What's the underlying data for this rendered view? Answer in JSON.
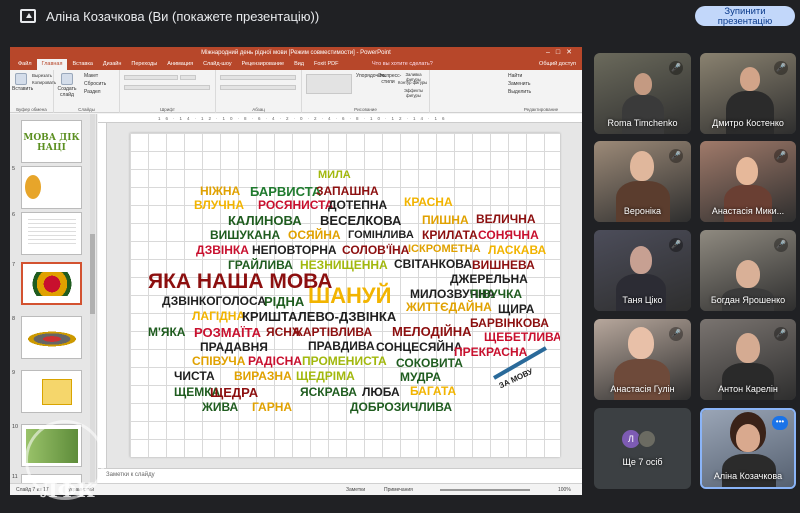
{
  "meet": {
    "title": "Аліна Козачкова (Ви (покажете презентацію))",
    "stop_button": "Зупинити\nпрезентацію"
  },
  "ppt": {
    "window_title": "Міжнародний день рідної мови  [Режим совместимости] - PowerPoint",
    "tabs": [
      "Файл",
      "Главная",
      "Вставка",
      "Дизайн",
      "Переходы",
      "Анимация",
      "Слайд-шоу",
      "Рецензирование",
      "Вид",
      "Foxit PDF"
    ],
    "tell_me": "Что вы хотите сделать?",
    "share": "Общий доступ",
    "ribbon": {
      "paste": "Вставить",
      "cut": "Вырезать",
      "copy": "Копировать",
      "format": "Формат по образцу",
      "clipboard": "Буфер обмена",
      "new_slide": "Создать слайд",
      "layout": "Макет",
      "reset": "Сбросить",
      "section": "Раздел",
      "slides": "Слайды",
      "font": "Шрифт",
      "paragraph": "Абзац",
      "arrange": "Упорядочить",
      "quick_styles": "Экспресс-стили",
      "shape_fill": "Заливка фигуры",
      "shape_outline": "Контур фигуры",
      "shape_effects": "Эффекты фигуры",
      "drawing": "Рисование",
      "find": "Найти",
      "replace": "Заменить",
      "select": "Выделить",
      "editing": "Редактирование"
    },
    "slide_numbers": [
      "5",
      "6",
      "7",
      "8",
      "9",
      "10",
      "11"
    ],
    "notes_placeholder": "Заметки к слайду",
    "status": {
      "slide": "Слайд 7 из 17",
      "language": "украинский",
      "notes": "Заметки",
      "comments": "Примечания",
      "zoom": "100%"
    },
    "thumb_title": "МОВА ДІК НАЦІ"
  },
  "slide_words": [
    {
      "t": "МИЛА",
      "c": "#a2b80d"
    },
    {
      "t": "НІЖНА",
      "c": "#e0a100"
    },
    {
      "t": "БАРВИСТА",
      "c": "#1f7a2e"
    },
    {
      "t": "ЗАПАШНА",
      "c": "#8c0f0f"
    },
    {
      "t": "ВЛУЧНА",
      "c": "#f2b400"
    },
    {
      "t": "РОСЯНИСТА",
      "c": "#c8102e"
    },
    {
      "t": "ДОТЕПНА",
      "c": "#1f1f1f"
    },
    {
      "t": "КРАСНА",
      "c": "#f2b400"
    },
    {
      "t": "КАЛИНОВА",
      "c": "#1f5c1f"
    },
    {
      "t": "ВЕСЕЛКОВА",
      "c": "#1f1f1f"
    },
    {
      "t": "ПИШНА",
      "c": "#e0a100"
    },
    {
      "t": "ВЕЛИЧНА",
      "c": "#8c0f0f"
    },
    {
      "t": "ВИШУКАНА",
      "c": "#1f5c1f"
    },
    {
      "t": "ОСЯЙНА",
      "c": "#e0a100"
    },
    {
      "t": "ГОМІНЛИВА",
      "c": "#1f1f1f"
    },
    {
      "t": "КРИЛАТА",
      "c": "#8c0f0f"
    },
    {
      "t": "СОНЯЧНА",
      "c": "#c8102e"
    },
    {
      "t": "ДЗВІНКА",
      "c": "#c8102e"
    },
    {
      "t": "НЕПОВТОРНА",
      "c": "#1f1f1f"
    },
    {
      "t": "СОЛОВ'ЇНА",
      "c": "#8c0f0f"
    },
    {
      "t": "ІСКРОМЕТНА",
      "c": "#e0a100"
    },
    {
      "t": "ЛАСКАВА",
      "c": "#f2b400"
    },
    {
      "t": "ГРАЙЛИВА",
      "c": "#1f5c1f"
    },
    {
      "t": "НЕЗНИЩЕННА",
      "c": "#a2b80d"
    },
    {
      "t": "СВІТАНКОВА",
      "c": "#1f1f1f"
    },
    {
      "t": "ВИШНЕВА",
      "c": "#8c0f0f"
    },
    {
      "t": "ЯКА НАША МОВА",
      "c": "#8c0f0f"
    },
    {
      "t": "ДЖЕРЕЛЬНА",
      "c": "#1f1f1f"
    },
    {
      "t": "ШАНУЙ",
      "c": "#f2b400"
    },
    {
      "t": "МИЛОЗВУЧНА",
      "c": "#1f1f1f"
    },
    {
      "t": "ПІВУЧКА",
      "c": "#1f5c1f"
    },
    {
      "t": "ДЗВІНКОГОЛОСА",
      "c": "#1f1f1f"
    },
    {
      "t": "РІДНА",
      "c": "#1f5c1f"
    },
    {
      "t": "ЖИТТЄДАЙНА",
      "c": "#e0a100"
    },
    {
      "t": "ЩИРА",
      "c": "#1f1f1f"
    },
    {
      "t": "ЛАГІДНА",
      "c": "#f2b400"
    },
    {
      "t": "КРИШТАЛЕВО-ДЗВІНКА",
      "c": "#1f1f1f"
    },
    {
      "t": "БАРВІНКОВА",
      "c": "#8c0f0f"
    },
    {
      "t": "М'ЯКА",
      "c": "#1f5c1f"
    },
    {
      "t": "РОЗМАЇТА",
      "c": "#c8102e"
    },
    {
      "t": "ЯСНА",
      "c": "#8c0f0f"
    },
    {
      "t": "ЖАРТІВЛИВА",
      "c": "#8c0f0f"
    },
    {
      "t": "МЕЛОДІЙНА",
      "c": "#8c0f0f"
    },
    {
      "t": "ЩЕБЕТЛИВА",
      "c": "#c8102e"
    },
    {
      "t": "ПРАДАВНЯ",
      "c": "#1f1f1f"
    },
    {
      "t": "ПРАВДИВА",
      "c": "#1f1f1f"
    },
    {
      "t": "СОНЦЕСЯЙНА",
      "c": "#1f1f1f"
    },
    {
      "t": "ПРЕКРАСНА",
      "c": "#c8102e"
    },
    {
      "t": "СПІВУЧА",
      "c": "#e0a100"
    },
    {
      "t": "РАДІСНА",
      "c": "#c8102e"
    },
    {
      "t": "ПРОМЕНИСТА",
      "c": "#a2b80d"
    },
    {
      "t": "СОКОВИТА",
      "c": "#1f5c1f"
    },
    {
      "t": "ЧИСТА",
      "c": "#1f1f1f"
    },
    {
      "t": "ВИРАЗНА",
      "c": "#e0a100"
    },
    {
      "t": "ЩЕДРІМА",
      "c": "#a2b80d"
    },
    {
      "t": "МУДРА",
      "c": "#1f5c1f"
    },
    {
      "t": "ЩЕМКА",
      "c": "#1f5c1f"
    },
    {
      "t": "ЩЕДРА",
      "c": "#8c0f0f"
    },
    {
      "t": "ЯСКРАВА",
      "c": "#1f5c1f"
    },
    {
      "t": "ЛЮБА",
      "c": "#1f1f1f"
    },
    {
      "t": "БАГАТА",
      "c": "#f2b400"
    },
    {
      "t": "ЖИВА",
      "c": "#1f5c1f"
    },
    {
      "t": "ГАРНА",
      "c": "#e0a100"
    },
    {
      "t": "ДОБРОЗИЧЛИВА",
      "c": "#1f5c1f"
    },
    {
      "t": "ЗА МОВУ",
      "c": "#1f1f1f"
    }
  ],
  "participants": [
    {
      "name": "Roma Timchenko",
      "bg": "#6b6a5c"
    },
    {
      "name": "Дмитро Костенко",
      "bg": "#8a8270"
    },
    {
      "name": "Вероніка",
      "bg": "#9c8a78"
    },
    {
      "name": "Анастасія Мики...",
      "bg": "#a07a6a"
    },
    {
      "name": "Таня Ціко",
      "bg": "#4c4d5a"
    },
    {
      "name": "Богдан Ярошенко",
      "bg": "#8f8a80"
    },
    {
      "name": "Анастасія Гулін",
      "bg": "#b7a79c"
    },
    {
      "name": "Антон Карелін",
      "bg": "#7a7470"
    }
  ],
  "more_tile": {
    "avatar_letter": "Л",
    "label": "Ще 7 осіб"
  },
  "self_tile": {
    "name": "Аліна Козачкова",
    "bg": "#9aa5b6"
  },
  "watermark": {
    "letters": "ЛФК",
    "ring_text": "ЛУГАНСЬКИЙ ФАХОВИЙ КОЛЕДЖ"
  }
}
